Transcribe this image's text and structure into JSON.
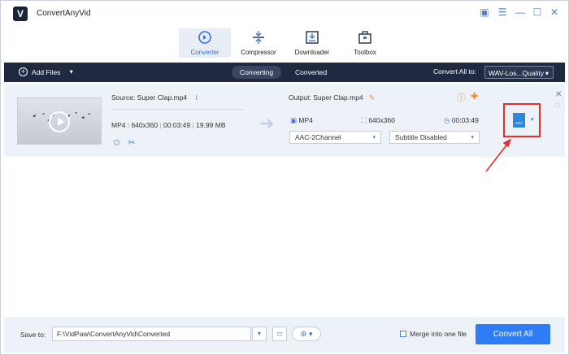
{
  "app": {
    "title": "ConvertAnyVid",
    "logo": "V"
  },
  "window_controls": [
    {
      "name": "feedback-icon",
      "glyph": "▣"
    },
    {
      "name": "menu-icon",
      "glyph": "☰"
    },
    {
      "name": "minimize-icon",
      "glyph": "—"
    },
    {
      "name": "maximize-icon",
      "glyph": "☐"
    },
    {
      "name": "close-icon",
      "glyph": "✕"
    }
  ],
  "nav": {
    "converter": "Converter",
    "compressor": "Compressor",
    "downloader": "Downloader",
    "toolbox": "Toolbox"
  },
  "toolbar": {
    "add_files": "Add Files",
    "add_caret": "▾",
    "tab_converting": "Converting",
    "tab_converted": "Converted",
    "convert_all_to_label": "Convert All to:",
    "convert_all_to_value": "WAV-Los...Quality",
    "select_caret": "▾"
  },
  "file": {
    "source": "Source: Super Clap.mp4",
    "info_icon": "i",
    "format": "MP4",
    "resolution": "640x360",
    "duration": "00:03:49",
    "size": "19.99 MB",
    "sep": "|",
    "output": "Output: Super Clap.mp4",
    "out_format": "MP4",
    "out_resolution": "640x360",
    "out_duration": "00:03:49",
    "audio": "AAC-2Channel",
    "subtitle": "Subtitle Disabled",
    "caret": "▾",
    "format_icon_label": "MP4"
  },
  "bottom": {
    "save_to_label": "Save to:",
    "save_path": "F:\\VidPaw\\ConvertAnyVid\\Converted",
    "merge_label": "Merge into one file",
    "convert_all_button": "Convert All"
  },
  "colors": {
    "accent": "#2e7cf6",
    "toolbar_bg": "#1f2940",
    "highlight": "#e5302a"
  }
}
